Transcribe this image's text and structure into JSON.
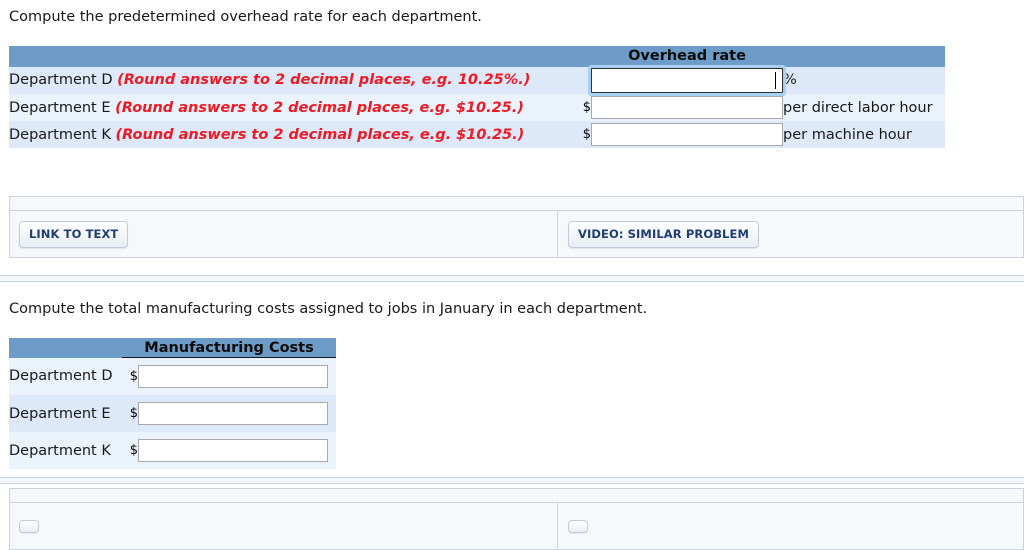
{
  "questions": {
    "q1_prompt": "Compute the predetermined overhead rate for each department.",
    "q2_prompt": "Compute the total manufacturing costs assigned to jobs in January in each department."
  },
  "colors": {
    "table_header_blue": "#6d9cc8",
    "row_odd": "#dde8f8",
    "row_even": "#eaf2fc",
    "hint_red": "#ee1b24",
    "button_text_navy": "#1f3e72",
    "focus_ring": "#a8d0f0"
  },
  "overhead_table": {
    "header_blank": "",
    "header_title": "Overhead rate",
    "rows": [
      {
        "label": "Department D",
        "hint": "(Round answers to 2 decimal places, e.g. 10.25%.)",
        "prefix": "",
        "value": "",
        "placeholder": "",
        "suffix": "%",
        "focused": true
      },
      {
        "label": "Department E",
        "hint": "(Round answers to 2 decimal places, e.g. $10.25.)",
        "prefix": "$",
        "value": "",
        "placeholder": "",
        "suffix": "per direct labor hour",
        "focused": false
      },
      {
        "label": "Department K",
        "hint": "(Round answers to 2 decimal places, e.g. $10.25.)",
        "prefix": "$",
        "value": "",
        "placeholder": "",
        "suffix": "per machine hour",
        "focused": false
      }
    ]
  },
  "mfg_table": {
    "header_blank": "",
    "header_title": "Manufacturing Costs",
    "rows": [
      {
        "label": "Department D",
        "prefix": "$",
        "value": "",
        "placeholder": ""
      },
      {
        "label": "Department E",
        "prefix": "$",
        "value": "",
        "placeholder": ""
      },
      {
        "label": "Department K",
        "prefix": "$",
        "value": "",
        "placeholder": ""
      }
    ]
  },
  "resource_panel_1": {
    "link_to_text_label": "LINK TO TEXT",
    "video_label": "VIDEO: SIMILAR PROBLEM"
  },
  "resource_panel_2": {
    "link_to_text_label": "",
    "video_label": ""
  }
}
